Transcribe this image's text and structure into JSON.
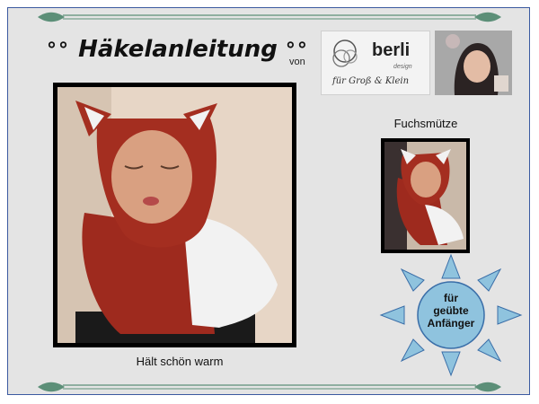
{
  "header": {
    "title_quote_open": "°°",
    "title": "Häkelanleitung",
    "title_quote_close": "°°",
    "von": "von"
  },
  "logo": {
    "brand": "berli",
    "design": "design",
    "tagline": "für Groß & Klein"
  },
  "main_photo": {
    "caption": "Hält schön warm"
  },
  "small_photo": {
    "label": "Fuchsmütze"
  },
  "badge": {
    "line1": "für",
    "line2": "geübte",
    "line3": "Anfänger"
  },
  "colors": {
    "frame_border": "#3b5aa0",
    "background": "#e4e4e4",
    "yarn_red": "#9e2a1e",
    "yarn_white": "#f2f2f2",
    "sun_fill": "#8fc3de",
    "sun_border": "#3a6ea8"
  }
}
